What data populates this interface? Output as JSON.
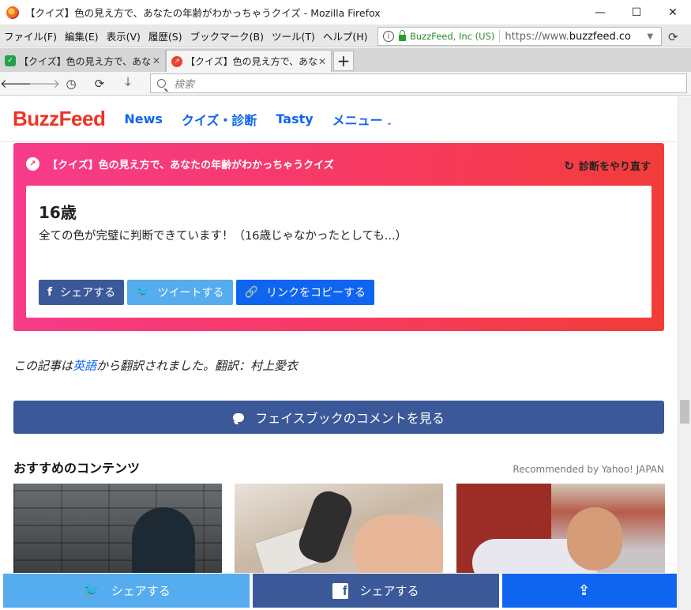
{
  "window": {
    "title": "【クイズ】色の見え方で、あなたの年齢がわかっちゃうクイズ - Mozilla Firefox",
    "controls": [
      "—",
      "☐",
      "✕"
    ]
  },
  "menubar": {
    "items": [
      "ファイル(F)",
      "編集(E)",
      "表示(V)",
      "履歴(S)",
      "ブックマーク(B)",
      "ツール(T)",
      "ヘルプ(H)"
    ]
  },
  "urlbar": {
    "identity": "BuzzFeed, Inc (US)",
    "url_prefix": "https://www.",
    "url_domain": "buzzfeed.co"
  },
  "tabs": [
    {
      "title": "【クイズ】色の見え方で、あなた",
      "active": false,
      "favicon_color": "#1fa34a"
    },
    {
      "title": "【クイズ】色の見え方で、あなた",
      "active": true,
      "favicon_color": "#e9422f"
    }
  ],
  "navbar": {
    "search_placeholder": "検索"
  },
  "site": {
    "logo": "BuzzFeed",
    "nav": [
      "News",
      "クイズ・診断",
      "Tasty",
      "メニュー"
    ],
    "brand_color": "#ee3322",
    "link_color": "#0f65ef"
  },
  "quiz": {
    "title": "【クイズ】色の見え方で、あなたの年齢がわかっちゃうクイズ",
    "retry_label": "診断をやり直す",
    "result_heading": "16歳",
    "result_text": "全ての色が完璧に判断できています！（16歳じゃなかったとしても...）",
    "share": {
      "facebook": "シェアする",
      "twitter": "ツイートする",
      "copy_link": "リンクをコピーする"
    }
  },
  "credit": {
    "before": "この記事は",
    "link": "英語",
    "after": "から翻訳されました。翻訳：村上愛衣"
  },
  "fb_comments_label": "フェイスブックのコメントを見る",
  "recommended": {
    "heading": "おすすめのコンテンツ",
    "by": "Recommended by Yahoo! JAPAN"
  },
  "bottom_bar": {
    "twitter": "シェアする",
    "facebook": "シェアする"
  }
}
